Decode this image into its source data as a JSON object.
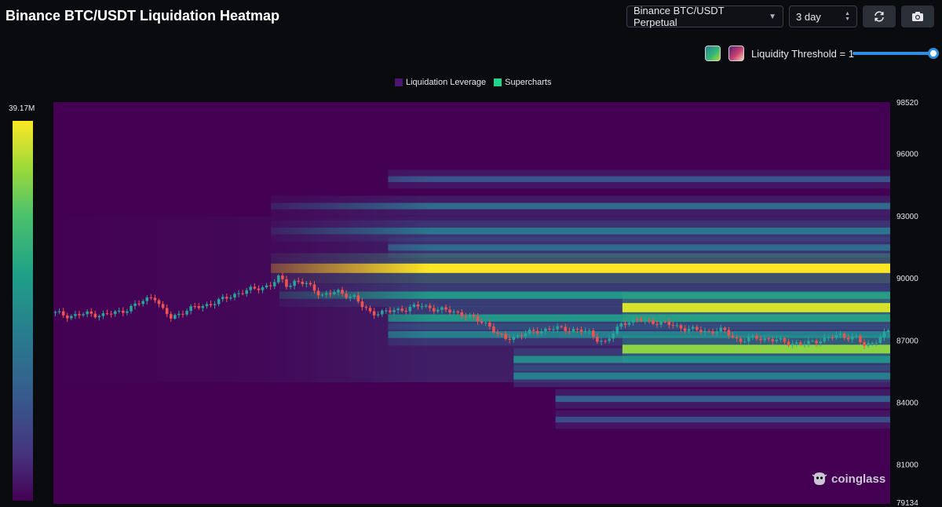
{
  "header": {
    "title": "Binance BTC/USDT Liquidation Heatmap",
    "exchange_select": "Binance BTC/USDT Perpetual",
    "period_select": "3 day"
  },
  "controls": {
    "threshold_label": "Liquidity Threshold = 1",
    "threshold_value": 1,
    "palettes": [
      "viridis",
      "magma"
    ],
    "icons": [
      "refresh-icon",
      "camera-icon"
    ]
  },
  "watermark": "coinglass",
  "colors": {
    "background": "#0a0b0e",
    "heat_low": "#440154",
    "heat_high": "#fde725",
    "candle_up": "#26a69a",
    "candle_down": "#ef5350",
    "accent": "#2f8ee0"
  },
  "chart_data": {
    "type": "heatmap",
    "title": "Binance BTC/USDT Liquidation Heatmap",
    "legend": [
      {
        "name": "Liquidation Leverage",
        "color": "#4b1670"
      },
      {
        "name": "Supercharts",
        "color": "#1ed78a"
      }
    ],
    "legend_position": "top-center",
    "colorbar": {
      "max_label": "39.17M",
      "min": 0,
      "max": 39170000
    },
    "y_axis": {
      "ticks": [
        98520,
        96000,
        93000,
        90000,
        87000,
        84000,
        81000,
        79134
      ],
      "range": [
        79134,
        98520
      ]
    },
    "bands": [
      {
        "price": 90500,
        "intensity": 1.0,
        "start": 0.26
      },
      {
        "price": 88600,
        "intensity": 0.95,
        "start": 0.68
      },
      {
        "price": 86600,
        "intensity": 0.85,
        "start": 0.68
      },
      {
        "price": 89200,
        "intensity": 0.55,
        "start": 0.27
      },
      {
        "price": 88100,
        "intensity": 0.55,
        "start": 0.4
      },
      {
        "price": 87300,
        "intensity": 0.45,
        "start": 0.4
      },
      {
        "price": 86100,
        "intensity": 0.5,
        "start": 0.55
      },
      {
        "price": 85300,
        "intensity": 0.45,
        "start": 0.55
      },
      {
        "price": 93500,
        "intensity": 0.35,
        "start": 0.26
      },
      {
        "price": 92300,
        "intensity": 0.4,
        "start": 0.26
      },
      {
        "price": 91500,
        "intensity": 0.35,
        "start": 0.4
      },
      {
        "price": 94800,
        "intensity": 0.25,
        "start": 0.4
      },
      {
        "price": 84200,
        "intensity": 0.3,
        "start": 0.6
      },
      {
        "price": 83200,
        "intensity": 0.22,
        "start": 0.6
      }
    ],
    "price_path": [
      [
        0.0,
        88350
      ],
      [
        0.02,
        88200
      ],
      [
        0.04,
        88300
      ],
      [
        0.06,
        88250
      ],
      [
        0.08,
        88400
      ],
      [
        0.1,
        88750
      ],
      [
        0.12,
        89200
      ],
      [
        0.13,
        88500
      ],
      [
        0.14,
        88100
      ],
      [
        0.16,
        88500
      ],
      [
        0.18,
        88700
      ],
      [
        0.2,
        88950
      ],
      [
        0.22,
        89300
      ],
      [
        0.24,
        89500
      ],
      [
        0.26,
        89700
      ],
      [
        0.27,
        90050
      ],
      [
        0.28,
        89650
      ],
      [
        0.29,
        89900
      ],
      [
        0.3,
        89750
      ],
      [
        0.31,
        89550
      ],
      [
        0.32,
        89200
      ],
      [
        0.34,
        89350
      ],
      [
        0.36,
        89100
      ],
      [
        0.37,
        88600
      ],
      [
        0.38,
        88350
      ],
      [
        0.4,
        88400
      ],
      [
        0.42,
        88550
      ],
      [
        0.44,
        88700
      ],
      [
        0.46,
        88500
      ],
      [
        0.48,
        88400
      ],
      [
        0.5,
        88100
      ],
      [
        0.52,
        87800
      ],
      [
        0.53,
        87300
      ],
      [
        0.54,
        87100
      ],
      [
        0.56,
        87300
      ],
      [
        0.58,
        87500
      ],
      [
        0.6,
        87600
      ],
      [
        0.62,
        87550
      ],
      [
        0.64,
        87400
      ],
      [
        0.65,
        87100
      ],
      [
        0.66,
        86900
      ],
      [
        0.67,
        87400
      ],
      [
        0.68,
        87900
      ],
      [
        0.7,
        88000
      ],
      [
        0.72,
        87900
      ],
      [
        0.74,
        87750
      ],
      [
        0.76,
        87550
      ],
      [
        0.78,
        87450
      ],
      [
        0.8,
        87500
      ],
      [
        0.81,
        87250
      ],
      [
        0.82,
        87000
      ],
      [
        0.84,
        87150
      ],
      [
        0.86,
        87050
      ],
      [
        0.88,
        86900
      ],
      [
        0.9,
        86850
      ],
      [
        0.92,
        87100
      ],
      [
        0.94,
        87250
      ],
      [
        0.96,
        87150
      ],
      [
        0.97,
        86700
      ],
      [
        0.98,
        86950
      ],
      [
        0.99,
        87250
      ],
      [
        1.0,
        87550
      ]
    ]
  }
}
